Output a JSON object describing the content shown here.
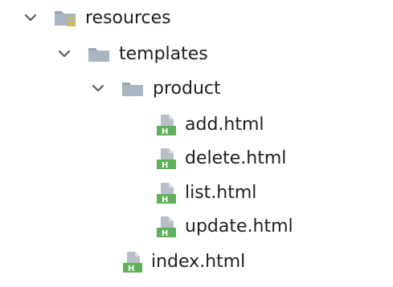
{
  "project_tree": {
    "nodes": [
      {
        "label": "resources",
        "kind": "resources-folder",
        "expanded": true,
        "depth": 0
      },
      {
        "label": "templates",
        "kind": "folder",
        "expanded": true,
        "depth": 1
      },
      {
        "label": "product",
        "kind": "folder",
        "expanded": true,
        "depth": 2
      },
      {
        "label": "add.html",
        "kind": "html-file",
        "depth": 3
      },
      {
        "label": "delete.html",
        "kind": "html-file",
        "depth": 3
      },
      {
        "label": "list.html",
        "kind": "html-file",
        "depth": 3
      },
      {
        "label": "update.html",
        "kind": "html-file",
        "depth": 3
      },
      {
        "label": "index.html",
        "kind": "html-file",
        "depth": 2
      }
    ]
  },
  "icons": {
    "chevron": "chevron-down-icon",
    "resources_folder": "resources-folder-icon",
    "folder": "folder-icon",
    "html_file": "html-file-icon"
  },
  "colors": {
    "folder": "#a9b5c3",
    "folder_tab": "#97a4b4",
    "html_badge": "#5fb25a",
    "file_sheet": "#b7bec7",
    "resources_bars": "#e0b94a",
    "chevron": "#5a5a5a",
    "text": "#1f1f1f"
  }
}
